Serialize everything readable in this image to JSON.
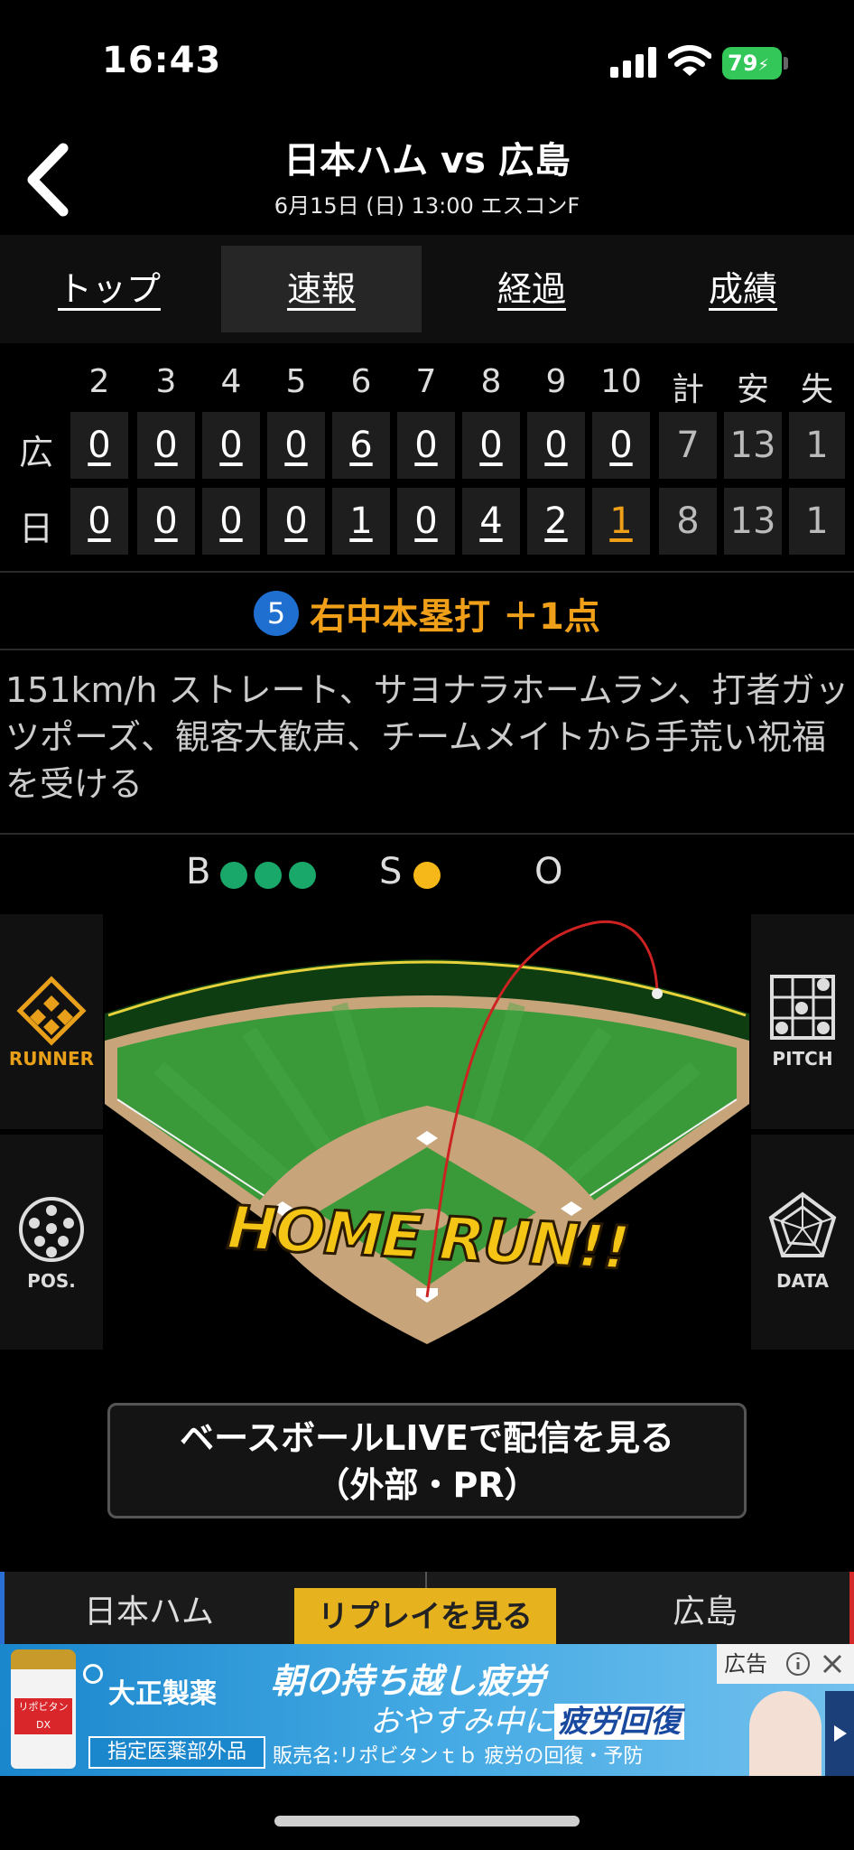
{
  "status": {
    "time": "16:43",
    "battery": "79"
  },
  "header": {
    "title": "日本ハム vs 広島",
    "subtitle": "6月15日 (日) 13:00 エスコンF"
  },
  "tabs": [
    {
      "label": "トップ",
      "active": false
    },
    {
      "label": "速報",
      "active": true
    },
    {
      "label": "経過",
      "active": false
    },
    {
      "label": "成績",
      "active": false
    }
  ],
  "scoreboard": {
    "columns": [
      "2",
      "3",
      "4",
      "5",
      "6",
      "7",
      "8",
      "9",
      "10",
      "計",
      "安",
      "失"
    ],
    "rows": [
      {
        "team": "広",
        "cells": [
          "0",
          "0",
          "0",
          "0",
          "6",
          "0",
          "0",
          "0",
          "0",
          "7",
          "13",
          "1"
        ]
      },
      {
        "team": "日",
        "cells": [
          "0",
          "0",
          "0",
          "0",
          "1",
          "0",
          "4",
          "2",
          "1",
          "8",
          "13",
          "1"
        ]
      }
    ]
  },
  "event": {
    "number": "5",
    "text": "右中本塁打 ＋1点"
  },
  "description": "151km/h ストレート、サヨナラホームラン、打者ガッツポーズ、観客大歓声、チームメイトから手荒い祝福を受ける",
  "count": {
    "b_label": "B",
    "s_label": "S",
    "o_label": "O",
    "balls": 3,
    "strikes": 1,
    "outs": 0,
    "ball_color": "#1aa86a",
    "strike_color": "#f5b818"
  },
  "field": {
    "runner_label": "RUNNER",
    "pitch_label": "PITCH",
    "pos_label": "POS.",
    "data_label": "DATA",
    "result_text": "HOME RUN!!"
  },
  "live_button": {
    "line1": "ベースボールLIVEで配信を見る",
    "line2": "（外部・PR）"
  },
  "bottom_tabs": {
    "home": "日本ハム",
    "replay": "リプレイを見る",
    "away": "広島"
  },
  "ad": {
    "brand": "大正製薬",
    "headline1": "朝の持ち越し疲労",
    "headline2_pre": "おやすみ中に",
    "headline2_em": "疲労回復",
    "tag": "指定医薬部外品",
    "footer": "販売名:リポビタンｔｂ 疲労の回復・予防",
    "label": "広告",
    "product": "リポビタン DX"
  }
}
